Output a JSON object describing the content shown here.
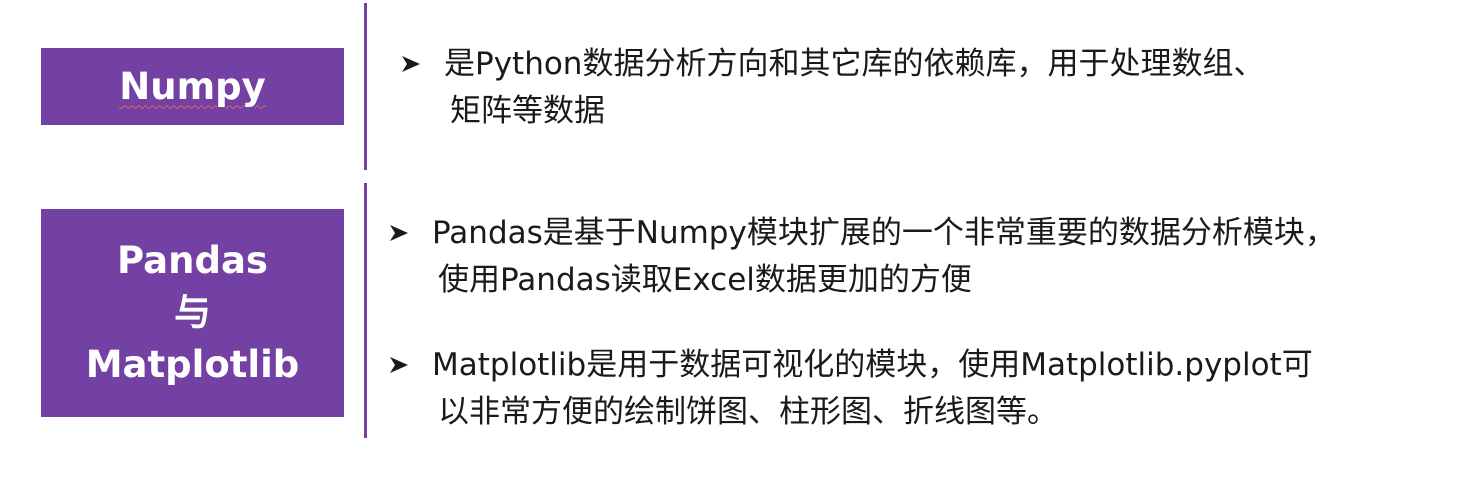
{
  "numpy_box": {
    "label": "Numpy"
  },
  "pandas_box": {
    "line1": "Pandas",
    "line2": "与",
    "line3": "Matplotlib"
  },
  "numpy_bullet": {
    "line1": "是Python数据分析方向和其它库的依赖库，用于处理数组、",
    "line2": "矩阵等数据"
  },
  "pandas_bullet": {
    "line1": "Pandas是基于Numpy模块扩展的一个非常重要的数据分析模块，",
    "line2": "使用Pandas读取Excel数据更加的方便"
  },
  "matplotlib_bullet": {
    "line1": "Matplotlib是用于数据可视化的模块，使用Matplotlib.pyplot可",
    "line2": "以非常方便的绘制饼图、柱形图、折线图等。"
  },
  "colors": {
    "accent": "#7340a3",
    "text": "#1a1a1a",
    "background": "#ffffff"
  },
  "icons": {
    "bullet": "arrow-bullet-icon"
  }
}
